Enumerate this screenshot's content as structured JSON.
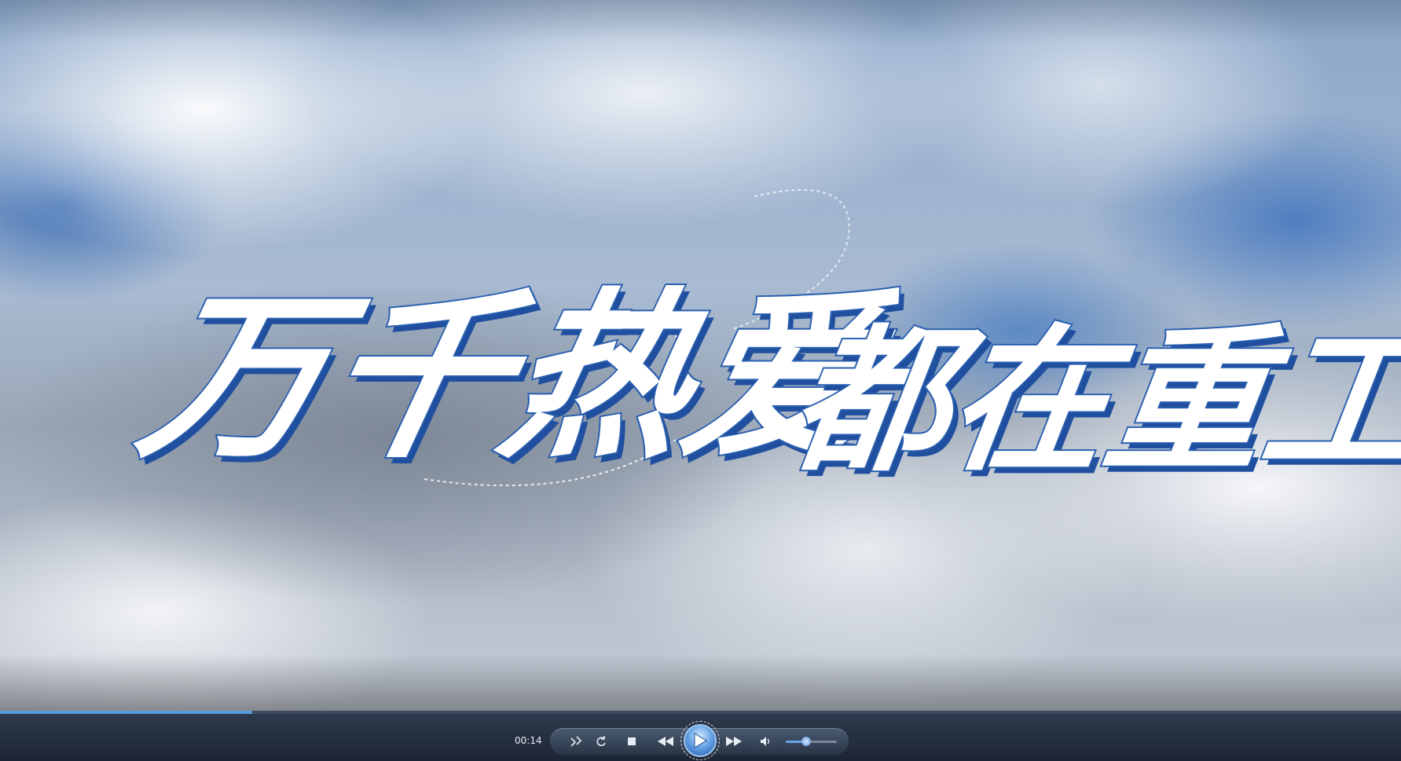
{
  "video": {
    "title_line1": "万千热爱",
    "title_line2": "都在重工"
  },
  "playback": {
    "time": "00:14",
    "progress": 0.18,
    "volume": 0.4,
    "state": "paused"
  },
  "controls": {
    "switch_icon": "switch-to-library-icon",
    "repeat_icon": "repeat-icon",
    "stop_icon": "stop-icon",
    "prev_icon": "rewind-icon",
    "play_icon": "play-icon",
    "next_icon": "fast-forward-icon",
    "volume_icon": "speaker-icon"
  },
  "colors": {
    "accent": "#5a9ae0",
    "title_outline": "#2a5fb0"
  }
}
